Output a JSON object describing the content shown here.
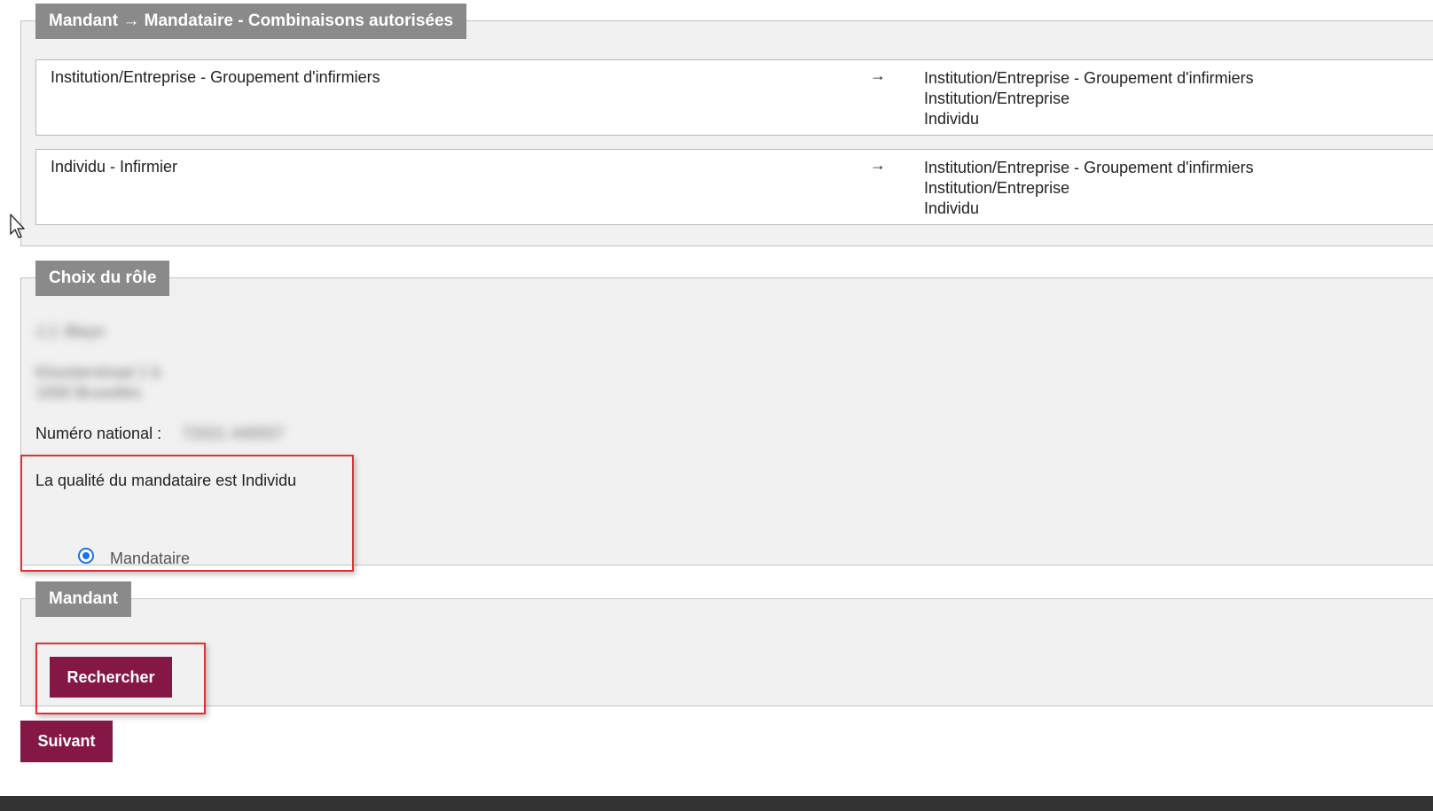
{
  "combinations": {
    "legend": "Mandant → Mandataire - Combinaisons autorisées",
    "rows": [
      {
        "from": "Institution/Entreprise - Groupement d'infirmiers",
        "arrow": "→",
        "to": [
          "Institution/Entreprise - Groupement d'infirmiers",
          "Institution/Entreprise",
          "Individu"
        ]
      },
      {
        "from": "Individu - Infirmier",
        "arrow": "→",
        "to": [
          "Institution/Entreprise - Groupement d'infirmiers",
          "Institution/Entreprise",
          "Individu"
        ]
      }
    ]
  },
  "role": {
    "legend": "Choix du rôle",
    "blurred_name": "J.J. Bleyn",
    "blurred_address_1": "Kloosterstraat 1 b",
    "blurred_address_2": "1000 Bruxelles",
    "national_number_label": "Numéro national :",
    "national_number_value": "72021 440557",
    "quality_text": "La qualité du mandataire est Individu",
    "option_label": "Mandataire",
    "option_selected": true
  },
  "mandant": {
    "legend": "Mandant",
    "search_button": "Rechercher"
  },
  "next_button": "Suivant",
  "colors": {
    "legend_bg": "#8a8a8a",
    "panel_bg": "#f1f1f1",
    "button_bg": "#841745",
    "highlight": "#e0302f",
    "radio": "#1a73e8"
  }
}
